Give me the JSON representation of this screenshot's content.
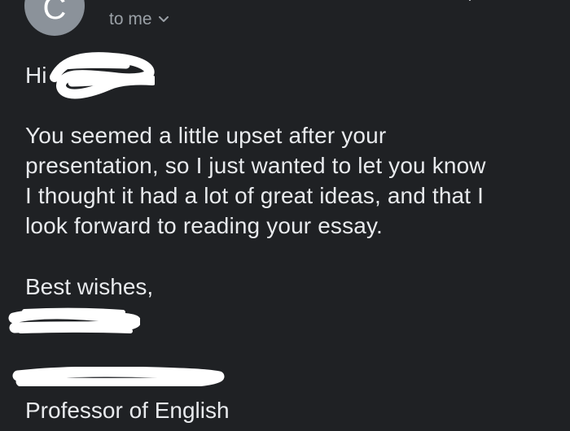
{
  "email": {
    "sender_initial": "C",
    "recipient_label": "to me",
    "greeting": "Hi",
    "body": "You seemed a little upset after your\npresentation, so I just wanted to let you know\nI thought it had a lot of great ideas, and that I\nlook forward to reading your essay.",
    "signoff": "Best wishes,",
    "sender_title": "Professor of English"
  },
  "icons": {
    "recipient_dropdown": "chevron-down-icon"
  },
  "colors": {
    "background": "#1f2124",
    "text": "#e8eaed",
    "muted_text": "#9aa0a6",
    "avatar": "#8b929a",
    "redaction": "#ffffff"
  }
}
